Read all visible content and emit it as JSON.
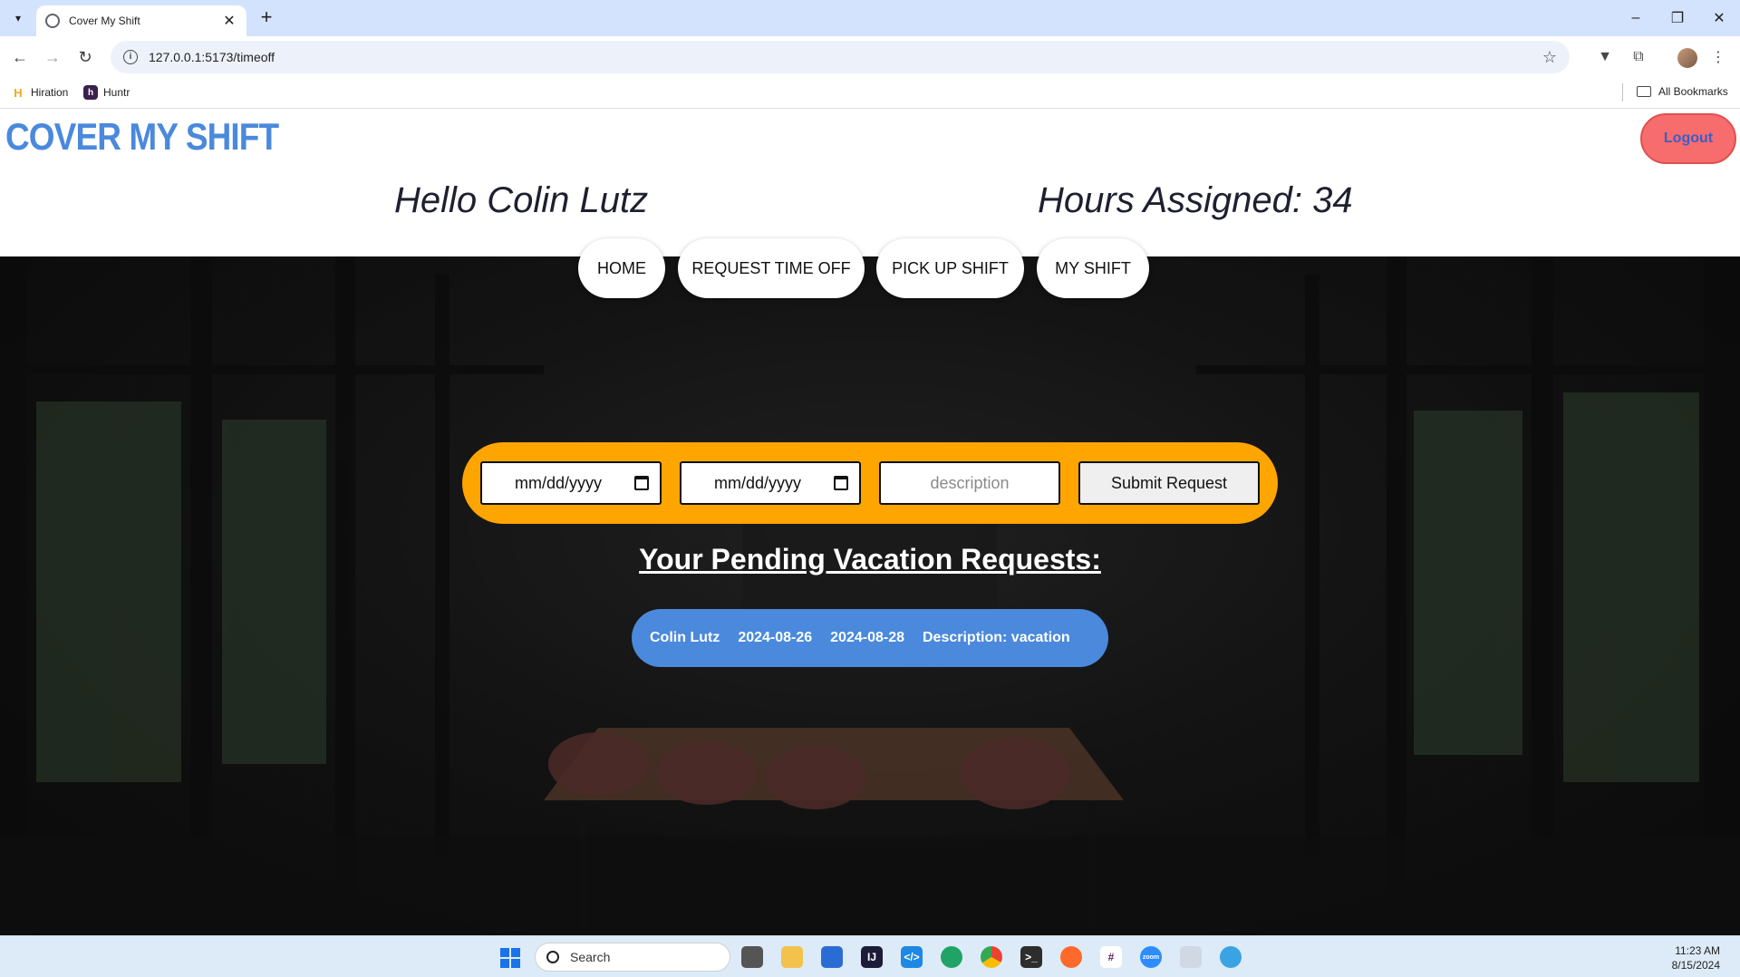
{
  "browser": {
    "tab_title": "Cover My Shift",
    "url": "127.0.0.1:5173/timeoff",
    "bookmarks": [
      {
        "label": "Hiration",
        "icon": "hiration-icon"
      },
      {
        "label": "Huntr",
        "icon": "huntr-icon"
      }
    ],
    "all_bookmarks_label": "All Bookmarks"
  },
  "header": {
    "logo": "COVER MY SHIFT",
    "logout_label": "Logout",
    "greeting": "Hello Colin Lutz",
    "hours": "Hours Assigned: 34"
  },
  "nav": {
    "items": [
      {
        "label": "HOME"
      },
      {
        "label": "REQUEST TIME OFF"
      },
      {
        "label": "PICK UP SHIFT"
      },
      {
        "label": "MY SHIFT"
      }
    ]
  },
  "form": {
    "start_date_placeholder": "mm/dd/yyyy",
    "end_date_placeholder": "mm/dd/yyyy",
    "description_placeholder": "description",
    "submit_label": "Submit Request"
  },
  "pending": {
    "title": "Your Pending Vacation Requests:",
    "requests": [
      {
        "name": "Colin Lutz",
        "start": "2024-08-26",
        "end": "2024-08-28",
        "description": "Description: vacation"
      }
    ]
  },
  "taskbar": {
    "search_placeholder": "Search",
    "time": "11:23 AM",
    "date": "8/15/2024"
  },
  "colors": {
    "logo": "#4a89dc",
    "logout_bg": "#f76c6c",
    "form_bar": "#ffa500",
    "request_pill": "#4a89dc"
  }
}
